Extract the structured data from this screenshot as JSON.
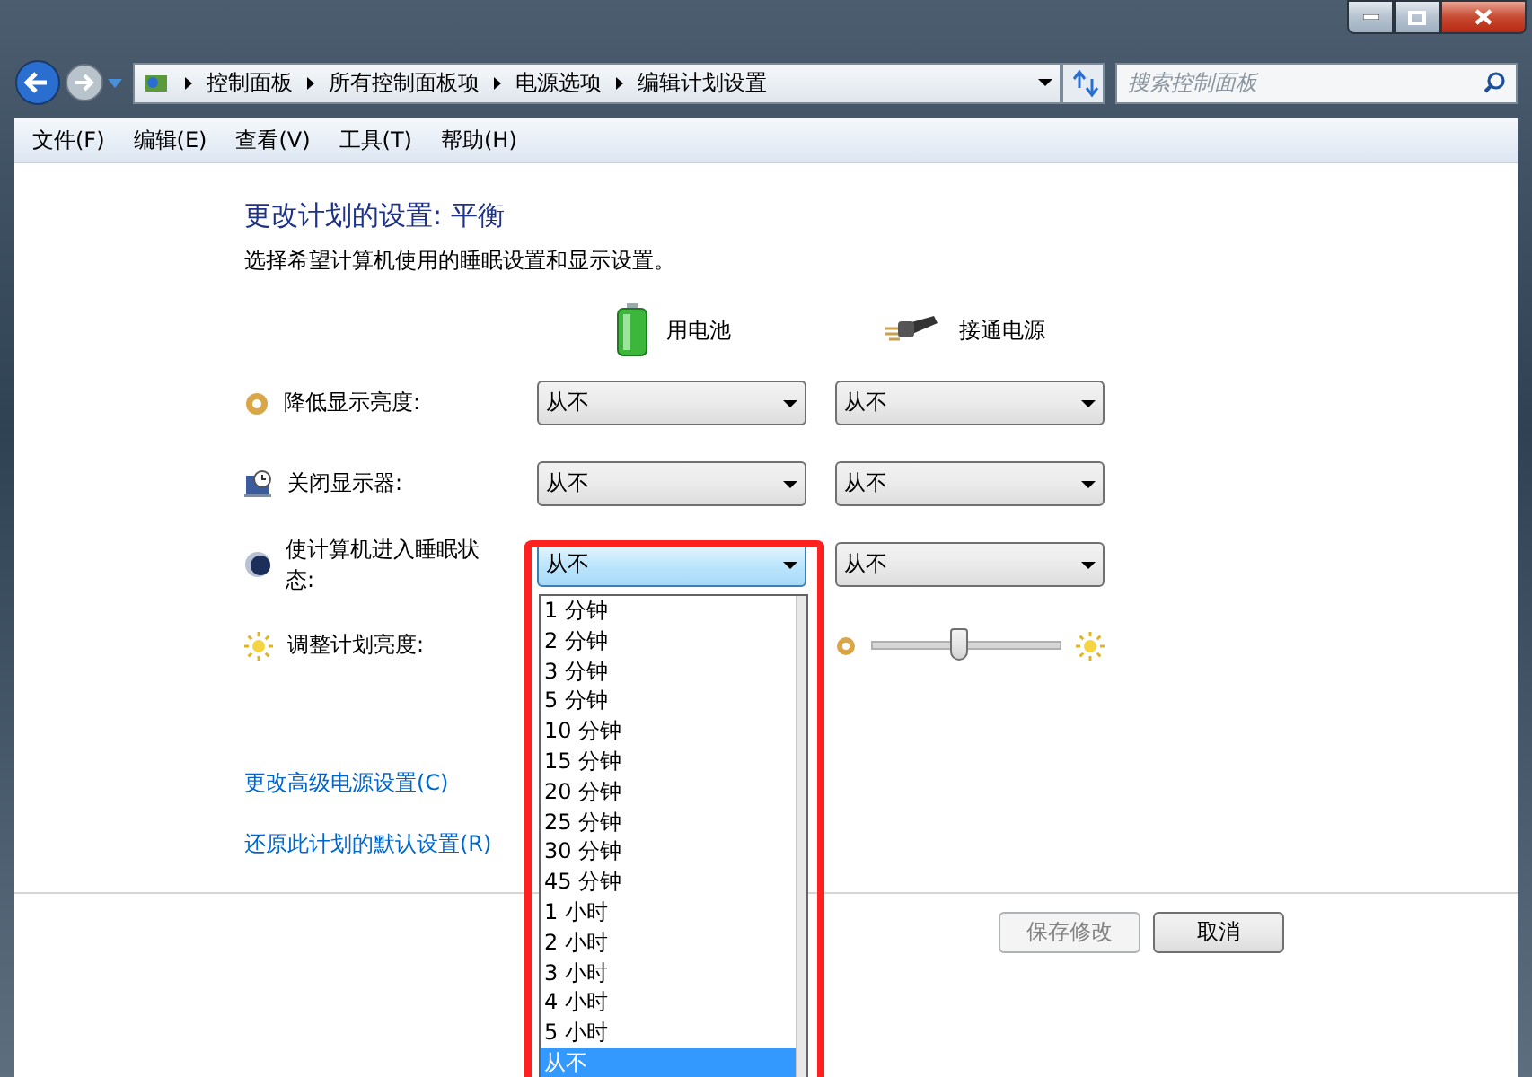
{
  "address_bar": {
    "crumbs": [
      "控制面板",
      "所有控制面板项",
      "电源选项",
      "编辑计划设置"
    ]
  },
  "search": {
    "placeholder": "搜索控制面板"
  },
  "menu": [
    "文件(F)",
    "编辑(E)",
    "查看(V)",
    "工具(T)",
    "帮助(H)"
  ],
  "heading": "更改计划的设置: 平衡",
  "subtitle": "选择希望计算机使用的睡眠设置和显示设置。",
  "columns": [
    {
      "label": "用电池",
      "kind": "battery"
    },
    {
      "label": "接通电源",
      "kind": "plug"
    }
  ],
  "settings": [
    {
      "label": "降低显示亮度:",
      "kind": "dim",
      "values": [
        {
          "kind": "select",
          "value": "从不",
          "open": false
        },
        {
          "kind": "select",
          "value": "从不",
          "open": false
        }
      ]
    },
    {
      "label": "关闭显示器:",
      "kind": "display",
      "values": [
        {
          "kind": "select",
          "value": "从不",
          "open": false
        },
        {
          "kind": "select",
          "value": "从不",
          "open": false
        }
      ]
    },
    {
      "label": "使计算机进入睡眠状态:",
      "kind": "sleep",
      "values": [
        {
          "kind": "select",
          "value": "从不",
          "open": true
        },
        {
          "kind": "select",
          "value": "从不",
          "open": false
        }
      ]
    },
    {
      "label": "调整计划亮度:",
      "kind": "brightness",
      "values": [
        {
          "kind": "covered"
        },
        {
          "kind": "slider",
          "level": 0.46
        }
      ]
    }
  ],
  "dropdown": {
    "options": [
      {
        "label": "1 分钟",
        "selected": false
      },
      {
        "label": "2 分钟",
        "selected": false
      },
      {
        "label": "3 分钟",
        "selected": false
      },
      {
        "label": "5 分钟",
        "selected": false
      },
      {
        "label": "10 分钟",
        "selected": false
      },
      {
        "label": "15 分钟",
        "selected": false
      },
      {
        "label": "20 分钟",
        "selected": false
      },
      {
        "label": "25 分钟",
        "selected": false
      },
      {
        "label": "30 分钟",
        "selected": false
      },
      {
        "label": "45 分钟",
        "selected": false
      },
      {
        "label": "1 小时",
        "selected": false
      },
      {
        "label": "2 小时",
        "selected": false
      },
      {
        "label": "3 小时",
        "selected": false
      },
      {
        "label": "4 小时",
        "selected": false
      },
      {
        "label": "5 小时",
        "selected": false
      },
      {
        "label": "从不",
        "selected": true
      }
    ]
  },
  "links": [
    "更改高级电源设置(C)",
    "还原此计划的默认设置(R)"
  ],
  "buttons": [
    {
      "label": "保存修改",
      "disabled": true
    },
    {
      "label": "取消",
      "disabled": false
    }
  ]
}
